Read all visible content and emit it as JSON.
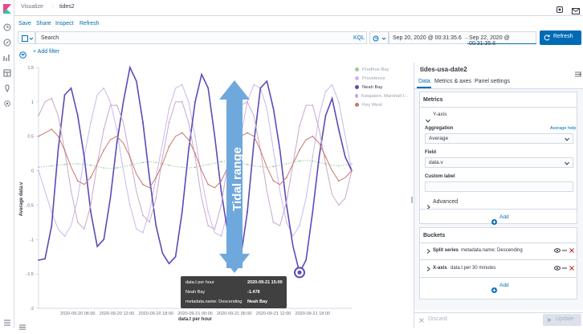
{
  "app": {
    "crumb_visualize": "Visualize",
    "crumb_title": "tides2"
  },
  "toolbar": {
    "save": "Save",
    "share": "Share",
    "inspect": "Inspect",
    "refresh": "Refresh"
  },
  "query": {
    "placeholder": "Search",
    "kql": "KQL",
    "start": "Sep 20, 2020 @ 00:31:35.6",
    "arrow": "→",
    "end": "Sep 22, 2020 @ 00:31:35.6",
    "refresh_button": "Refresh"
  },
  "filters": {
    "add_filter": "+ Add filter"
  },
  "annotation": {
    "text": "Tidal range"
  },
  "legend": [
    "Prudhoe Bay",
    "Providence",
    "Neah Bay",
    "Kwajalein, Marshall I...",
    "Key West"
  ],
  "tooltip": {
    "rows": [
      {
        "label": "data.t per hour",
        "value": "2020-09-21 15:00"
      },
      {
        "label": "Neah Bay",
        "value": "-1.478"
      },
      {
        "label": "metadata.name: Descending",
        "value": "Neah Bay"
      }
    ]
  },
  "chart_data": {
    "type": "line",
    "xlabel": "data.t per hour",
    "ylabel": "Average data.v",
    "ylim": [
      -2,
      1.5
    ],
    "yticks": [
      "1.5",
      "1",
      "0.5",
      "0",
      "-0.5",
      "-1",
      "-1.5",
      "-2"
    ],
    "xticks": [
      "2020-09-20 06:00",
      "2020-09-20 12:00",
      "2020-09-20 18:00",
      "2020-09-21 00:00",
      "2020-09-21 06:00",
      "2020-09-21 12:00",
      "2020-09-21 18:00"
    ],
    "x_hours": [
      0,
      1,
      2,
      3,
      4,
      5,
      6,
      7,
      8,
      9,
      10,
      11,
      12,
      13,
      14,
      15,
      16,
      17,
      18,
      19,
      20,
      21,
      22,
      23,
      24,
      25,
      26,
      27,
      28,
      29,
      30,
      31,
      32,
      33,
      34,
      35,
      36,
      37,
      38,
      39,
      40,
      41,
      42,
      43,
      44,
      45,
      46,
      47,
      48
    ],
    "series": [
      {
        "name": "Prudhoe Bay",
        "color": "#9bcf9b",
        "values": [
          0.05,
          0.06,
          0.07,
          0.08,
          0.09,
          0.1,
          0.1,
          0.09,
          0.08,
          0.06,
          0.04,
          0.03,
          0.04,
          0.06,
          0.08,
          0.1,
          0.12,
          0.13,
          0.12,
          0.1,
          0.08,
          0.06,
          0.05,
          0.04,
          0.05,
          0.07,
          0.09,
          0.11,
          0.13,
          0.14,
          0.13,
          0.11,
          0.09,
          0.07,
          0.06,
          0.05,
          0.06,
          0.08,
          0.1,
          0.12,
          0.14,
          0.15,
          0.14,
          0.12,
          0.1,
          0.08,
          0.07,
          0.08,
          0.1
        ]
      },
      {
        "name": "Providence",
        "color": "#c9b8ec",
        "values": [
          0.0,
          -0.3,
          -0.6,
          -0.85,
          -0.95,
          -0.8,
          -0.4,
          0.2,
          0.7,
          1.1,
          1.2,
          1.0,
          0.6,
          0.0,
          -0.5,
          -0.85,
          -0.9,
          -0.6,
          -0.1,
          0.4,
          0.9,
          1.2,
          1.25,
          1.0,
          0.5,
          -0.1,
          -0.6,
          -0.9,
          -0.95,
          -0.6,
          -0.1,
          0.5,
          1.0,
          1.25,
          1.2,
          0.9,
          0.3,
          -0.3,
          -0.75,
          -0.95,
          -0.8,
          -0.4,
          0.2,
          0.8,
          1.15,
          1.25,
          1.0,
          0.5,
          0.0
        ]
      },
      {
        "name": "Neah Bay",
        "color": "#5a4bb8",
        "values": [
          -1.3,
          -1.28,
          -0.8,
          0.3,
          1.1,
          1.2,
          0.8,
          0.2,
          -0.6,
          -1.1,
          -1.0,
          -0.4,
          0.4,
          1.0,
          1.5,
          1.3,
          0.7,
          -0.1,
          -0.8,
          -1.2,
          -1.35,
          -1.25,
          -0.6,
          0.3,
          1.0,
          1.4,
          1.2,
          0.5,
          -0.3,
          -0.9,
          -1.3,
          -1.25,
          -0.6,
          0.4,
          1.2,
          1.3,
          0.9,
          0.3,
          -0.5,
          -1.1,
          -1.48,
          -1.3,
          -0.6,
          0.2,
          0.8,
          1.05,
          0.6,
          0.2,
          0.0
        ]
      },
      {
        "name": "Kwajalein, Marshall I...",
        "color": "#caa8c9",
        "values": [
          0.8,
          1.0,
          1.05,
          0.8,
          0.3,
          -0.3,
          -0.75,
          -0.85,
          -0.5,
          0.1,
          0.6,
          0.95,
          0.95,
          0.7,
          0.2,
          -0.3,
          -0.65,
          -0.75,
          -0.4,
          0.2,
          0.7,
          1.0,
          1.0,
          0.7,
          0.2,
          -0.4,
          -0.8,
          -0.85,
          -0.5,
          0.1,
          0.6,
          0.95,
          1.0,
          0.8,
          0.3,
          -0.3,
          -0.75,
          -0.8,
          -0.45,
          0.1,
          0.65,
          0.95,
          0.95,
          0.6,
          0.1,
          -0.35,
          -0.5,
          -0.4,
          0.0
        ]
      },
      {
        "name": "Key West",
        "color": "#c8776e",
        "values": [
          0.5,
          0.55,
          0.6,
          0.5,
          0.3,
          0.05,
          -0.15,
          -0.2,
          -0.1,
          0.1,
          0.3,
          0.45,
          0.5,
          0.4,
          0.2,
          -0.05,
          -0.2,
          -0.25,
          -0.1,
          0.1,
          0.35,
          0.5,
          0.55,
          0.45,
          0.25,
          0.0,
          -0.2,
          -0.25,
          -0.15,
          0.05,
          0.3,
          0.5,
          0.55,
          0.5,
          0.3,
          0.05,
          -0.15,
          -0.2,
          -0.1,
          0.1,
          0.3,
          0.45,
          0.5,
          0.4,
          0.2,
          0.0,
          -0.15,
          -0.1,
          0.0
        ]
      }
    ]
  },
  "sidebar": {
    "title": "tides-usa-date2",
    "tabs": [
      "Data",
      "Metrics & axes",
      "Panel settings"
    ],
    "metrics_title": "Metrics",
    "yaxis_label": "Y-axis",
    "aggregation_label": "Aggregation",
    "average_help": "Average help",
    "aggregation_value": "Average",
    "field_label": "Field",
    "field_value": "data.v",
    "custom_label": "Custom label",
    "custom_label_value": "",
    "advanced": "Advanced",
    "add": "Add",
    "buckets_title": "Buckets",
    "split_series_bold": "Split series",
    "split_series_detail": "metadata.name: Descending",
    "xaxis_bold": "X-axis",
    "xaxis_detail": "data.t per 30 minutes",
    "add2": "Add",
    "discard": "Discard",
    "update": "Update"
  }
}
